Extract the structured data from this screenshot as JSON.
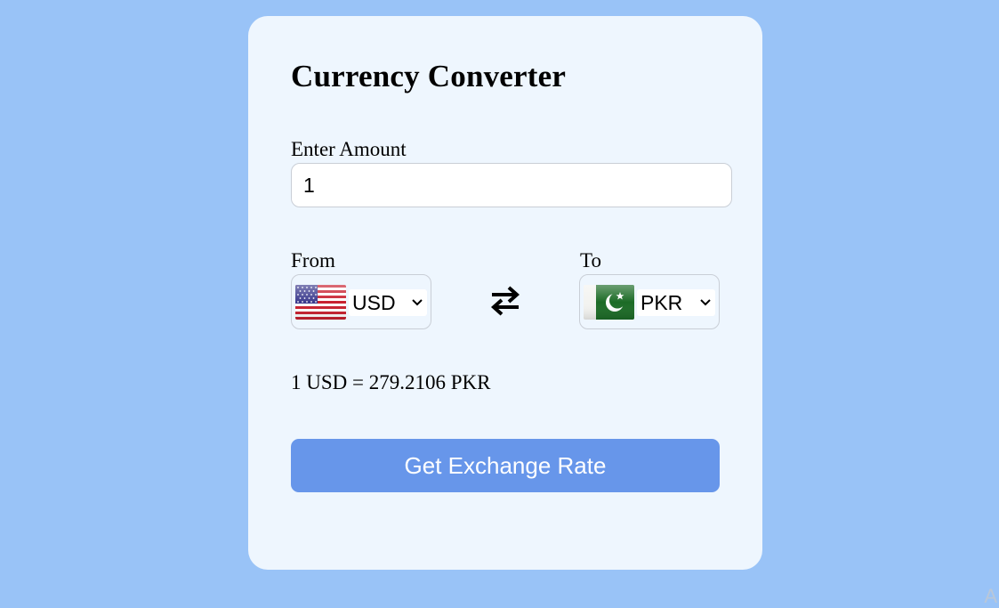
{
  "card": {
    "title": "Currency Converter"
  },
  "amount": {
    "label": "Enter Amount",
    "value": "1"
  },
  "from": {
    "label": "From",
    "currency": "USD",
    "flag_icon": "us-flag-icon"
  },
  "to": {
    "label": "To",
    "currency": "PKR",
    "flag_icon": "pk-flag-icon"
  },
  "swap_icon": "swap-arrows-icon",
  "result": {
    "text": "1 USD = 279.2106 PKR"
  },
  "button": {
    "label": "Get Exchange Rate"
  },
  "corner": {
    "glyph": "A"
  },
  "colors": {
    "background": "#99c3f7",
    "card": "#eef6fe",
    "button": "#6796ea"
  }
}
